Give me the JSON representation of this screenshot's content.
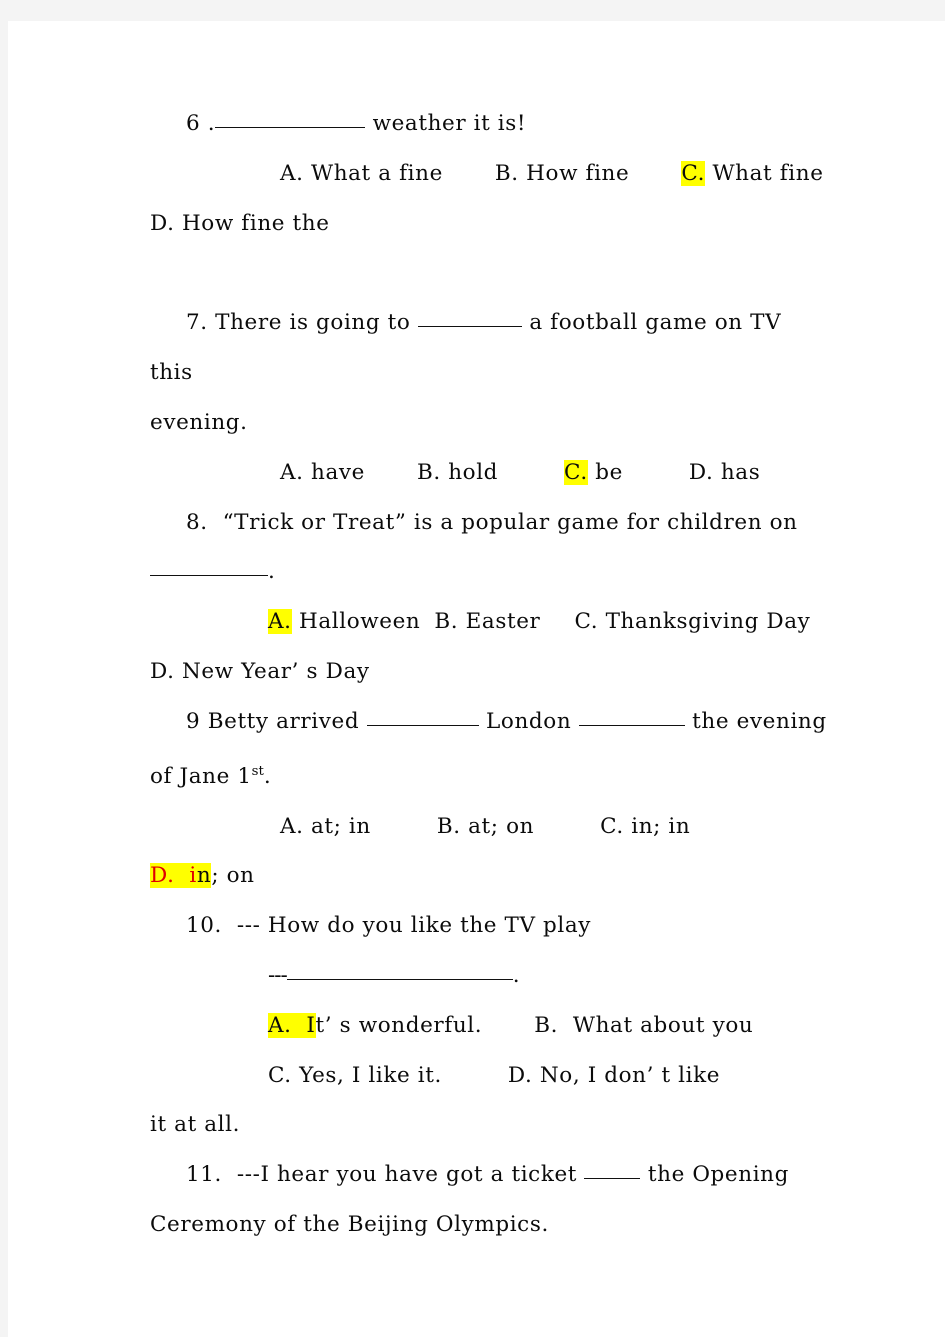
{
  "page": {
    "background_color": "#ffffff",
    "frame_color": "#f4f4f4",
    "highlight_color": "#ffff00",
    "highlight_text_color": "#e00000",
    "text_color": "#0b0b0b"
  },
  "questions": [
    {
      "number": "6 .",
      "stem_after_blank": " weather it is!",
      "options_line_1": {
        "a_label": "A.",
        "a_text": " What a fine",
        "b_label": "B.",
        "b_text": " How fine",
        "c_label": "C.",
        "c_text": " What fine",
        "c_highlighted": true
      },
      "options_line_2": {
        "d_label": "D.",
        "d_text": " How fine the"
      }
    },
    {
      "number": "7.",
      "stem_before_blank": " There is going to ",
      "stem_after_blank": " a football game on TV this",
      "stem_wrap": "evening.",
      "options_line_1": {
        "a_label": "A.",
        "a_text": " have",
        "b_label": "B.",
        "b_text": " hold",
        "c_label": "C.",
        "c_text": " be",
        "c_highlighted": true,
        "d_label": "D.",
        "d_text": " has"
      }
    },
    {
      "number": "8.",
      "stem_text": "  “Trick or Treat” is a popular game for children on",
      "stem_wrap_after_blank": ".",
      "options_line_1": {
        "a_label": "A.",
        "a_text": " Halloween",
        "a_highlighted": true,
        "b_label": "B.",
        "b_text": " Easter",
        "c_label": "C.",
        "c_text": " Thanksgiving Day"
      },
      "options_line_2": {
        "d_label": "D.",
        "d_text": " New Year’ s Day"
      }
    },
    {
      "number": "9",
      "stem_before_blank1": " Betty arrived ",
      "stem_between_blanks": " London ",
      "stem_after_blank2": " the evening",
      "stem_wrap_pre": "of Jane 1",
      "stem_wrap_sup": "st",
      "stem_wrap_post": ".",
      "options_line_1": {
        "a_label": "A.",
        "a_text": " at; in",
        "b_label": "B.",
        "b_text": " at; on",
        "c_label": "C.",
        "c_text": " in; in"
      },
      "options_line_2": {
        "d_label_highlighted": "D.  i",
        "d_text_rest": "n",
        "d_text_tail": "; on"
      }
    },
    {
      "number": "10.",
      "stem_text": "  --- How do you like the TV play",
      "answer_prompt_dashes": "---",
      "answer_prompt_period": ".",
      "options_line_1": {
        "a_label_highlighted": "A.  I",
        "a_text": "t’ s wonderful.",
        "b_label": "B.",
        "b_text": "  What about you"
      },
      "options_line_2": {
        "c_label": "C.",
        "c_text": " Yes, I like it.",
        "d_label": "D.",
        "d_text": " No, I don’ t like"
      },
      "options_wrap": "it at all."
    },
    {
      "number": "11.",
      "stem_before_blank": "  ---I hear you have got a ticket ",
      "stem_after_blank": " the Opening",
      "stem_wrap": "Ceremony of the Beijing Olympics."
    }
  ]
}
